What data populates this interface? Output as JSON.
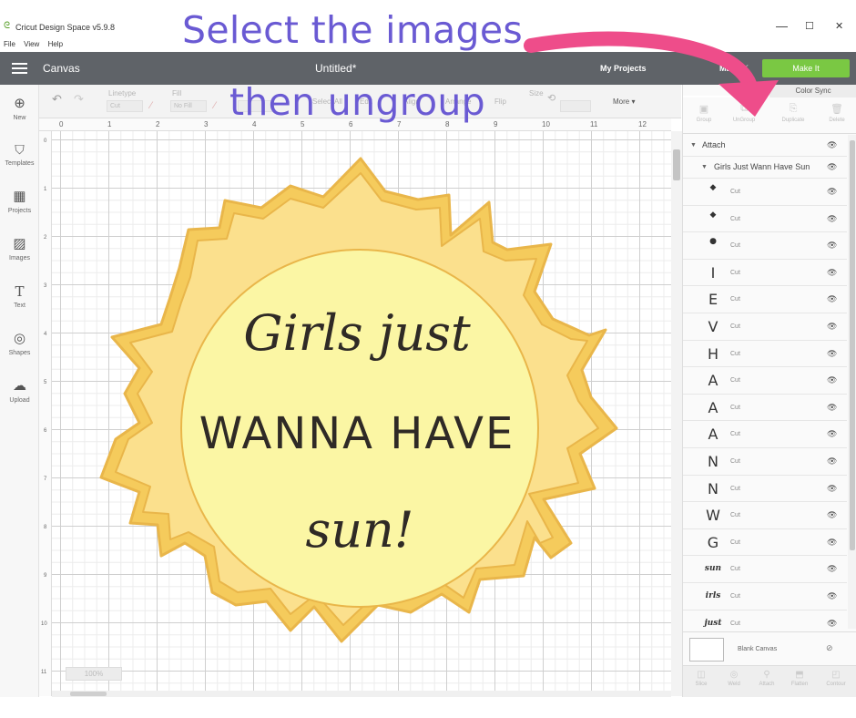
{
  "overlay": {
    "title": "Select the images",
    "subtitle": "then ungroup",
    "color": "#6a5ad3",
    "arrow_color": "#ee4d8a"
  },
  "window": {
    "app_title": "Cricut Design Space  v5.9.8",
    "minimize": "—",
    "maximize": "☐",
    "close": "✕",
    "menu": [
      "File",
      "View",
      "Help"
    ]
  },
  "header": {
    "canvas_label": "Canvas",
    "doc_title": "Untitled*",
    "my_projects": "My Projects",
    "machine": "Maker",
    "make_it": "Make It"
  },
  "toolbar": {
    "items": [
      "Linetype",
      "Fill",
      "Operation",
      "Select All",
      "Edit",
      "Align",
      "Arrange",
      "Flip",
      "Size",
      "Rotate"
    ],
    "more": "More ▾"
  },
  "sidebar": {
    "items": [
      {
        "label": "New",
        "icon": "⊕"
      },
      {
        "label": "Templates",
        "icon": "👕"
      },
      {
        "label": "Projects",
        "icon": "▦"
      },
      {
        "label": "Images",
        "icon": "▨"
      },
      {
        "label": "Text",
        "icon": "T"
      },
      {
        "label": "Shapes",
        "icon": "◎"
      },
      {
        "label": "Upload",
        "icon": "☁"
      }
    ]
  },
  "rulers": {
    "top": [
      "0",
      "1",
      "2",
      "3",
      "4",
      "5",
      "6",
      "7",
      "8",
      "9",
      "10",
      "11",
      "12"
    ],
    "left": [
      "0",
      "1",
      "2",
      "3",
      "4",
      "5",
      "6",
      "7",
      "8",
      "9",
      "10",
      "11"
    ]
  },
  "canvas": {
    "zoom": "100%"
  },
  "design": {
    "line1": "Girls just",
    "line2": "WANNA HAVE",
    "line3": "sun!",
    "ray_outer": "#f5cb5c",
    "ray_inner": "#fbe08d",
    "outline": "#e9b64a",
    "circle": "#fbf6a4"
  },
  "panel": {
    "tabs": {
      "layers": "Layers",
      "color_sync": "Color Sync"
    },
    "actions": [
      "Group",
      "UnGroup",
      "Duplicate",
      "Delete"
    ],
    "attach_label": "Attach",
    "group_label": "Girls Just Wann Have Sun",
    "layers": [
      {
        "glyph": "◆",
        "op": "Cut"
      },
      {
        "glyph": "◆",
        "op": "Cut"
      },
      {
        "glyph": "●",
        "op": "Cut"
      },
      {
        "glyph": "I",
        "op": "Cut"
      },
      {
        "glyph": "E",
        "op": "Cut"
      },
      {
        "glyph": "V",
        "op": "Cut"
      },
      {
        "glyph": "H",
        "op": "Cut"
      },
      {
        "glyph": "A",
        "op": "Cut"
      },
      {
        "glyph": "A",
        "op": "Cut"
      },
      {
        "glyph": "A",
        "op": "Cut"
      },
      {
        "glyph": "N",
        "op": "Cut"
      },
      {
        "glyph": "N",
        "op": "Cut"
      },
      {
        "glyph": "W",
        "op": "Cut"
      },
      {
        "glyph": "G",
        "op": "Cut"
      },
      {
        "glyph": "sun",
        "op": "Cut"
      },
      {
        "glyph": "irls",
        "op": "Cut"
      },
      {
        "glyph": "just",
        "op": "Cut"
      }
    ],
    "blank_canvas": "Blank Canvas",
    "bottom_actions": [
      "Slice",
      "Weld",
      "Attach",
      "Flatten",
      "Contour"
    ]
  }
}
